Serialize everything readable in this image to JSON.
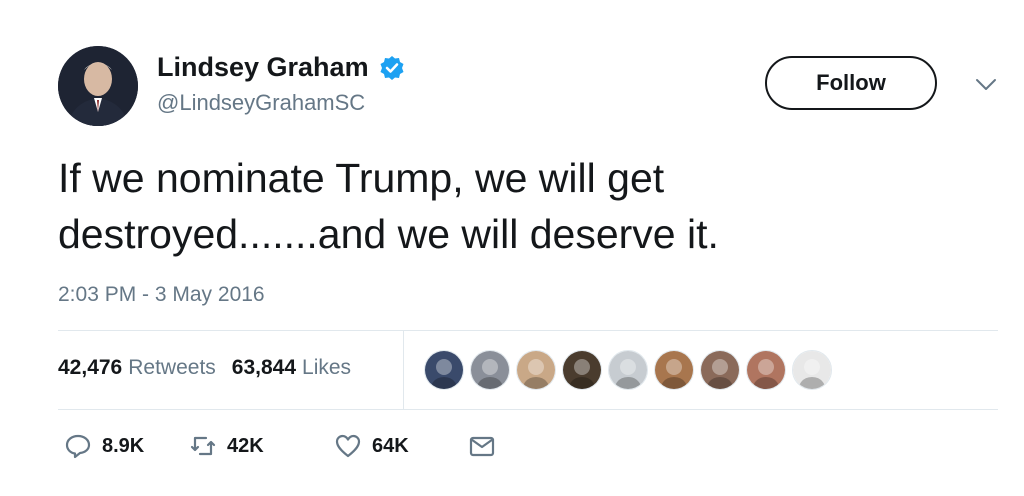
{
  "author": {
    "display_name": "Lindsey Graham",
    "handle": "@LindseyGrahamSC",
    "verified": true,
    "verified_color": "#1da1f2"
  },
  "header": {
    "follow_label": "Follow",
    "menu_icon": "chevron-down-icon"
  },
  "tweet": {
    "text": "If we nominate Trump, we will get\ndestroyed.......and we will deserve it.",
    "timestamp": "2:03 PM - 3 May 2016"
  },
  "stats": {
    "retweets_count": "42,476",
    "retweets_label": "Retweets",
    "likes_count": "63,844",
    "likes_label": "Likes"
  },
  "likers": [
    {
      "icon": "liker-avatar-1",
      "color": "#3a4a6b"
    },
    {
      "icon": "liker-avatar-2",
      "color": "#8a8f99"
    },
    {
      "icon": "liker-avatar-3",
      "color": "#c9a887"
    },
    {
      "icon": "liker-avatar-4",
      "color": "#4a3c2e"
    },
    {
      "icon": "liker-avatar-5",
      "color": "#c7ccd1"
    },
    {
      "icon": "liker-avatar-6",
      "color": "#a8764e"
    },
    {
      "icon": "liker-avatar-7",
      "color": "#8a6a5a"
    },
    {
      "icon": "liker-avatar-8",
      "color": "#b07560"
    },
    {
      "icon": "liker-avatar-9",
      "color": "#e8e8e8"
    }
  ],
  "actions": {
    "reply_count": "8.9K",
    "retweet_count": "42K",
    "like_count": "64K",
    "message_icon": "envelope-icon"
  }
}
